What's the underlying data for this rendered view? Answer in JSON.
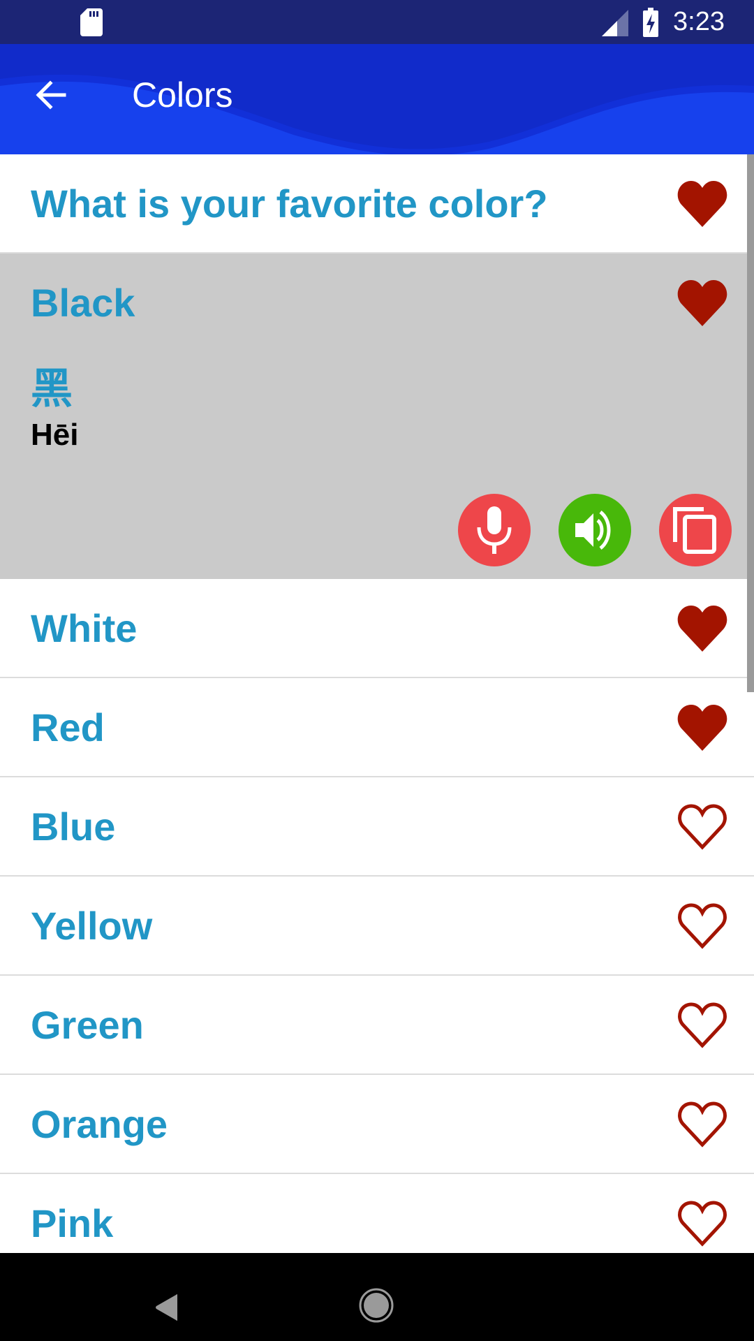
{
  "status_bar": {
    "time": "3:23",
    "icons": [
      "sd-card-icon",
      "cellular-signal-icon",
      "battery-charging-icon"
    ]
  },
  "app_bar": {
    "title": "Colors",
    "back_icon": "arrow-back-icon"
  },
  "list": {
    "items": [
      {
        "label": "What is your favorite color?",
        "favorite": true
      },
      {
        "label": "Black",
        "favorite": true,
        "expanded": true,
        "chinese": "黑",
        "pinyin": "Hēi",
        "actions": [
          {
            "name": "record",
            "icon": "microphone-icon",
            "color": "#ee464a"
          },
          {
            "name": "play",
            "icon": "speaker-icon",
            "color": "#48b80a"
          },
          {
            "name": "copy",
            "icon": "copy-icon",
            "color": "#ee464a"
          }
        ]
      },
      {
        "label": "White",
        "favorite": true
      },
      {
        "label": "Red",
        "favorite": true
      },
      {
        "label": "Blue",
        "favorite": false
      },
      {
        "label": "Yellow",
        "favorite": false
      },
      {
        "label": "Green",
        "favorite": false
      },
      {
        "label": "Orange",
        "favorite": false
      },
      {
        "label": "Pink",
        "favorite": false
      }
    ]
  },
  "colors": {
    "accent_text": "#2196c6",
    "heart": "#a31400",
    "status_bar": "#1c2575",
    "app_bar": "#1230d8",
    "expanded_bg": "#cacaca"
  },
  "nav_bar": {
    "icons": [
      "nav-back-icon",
      "nav-home-icon"
    ]
  }
}
